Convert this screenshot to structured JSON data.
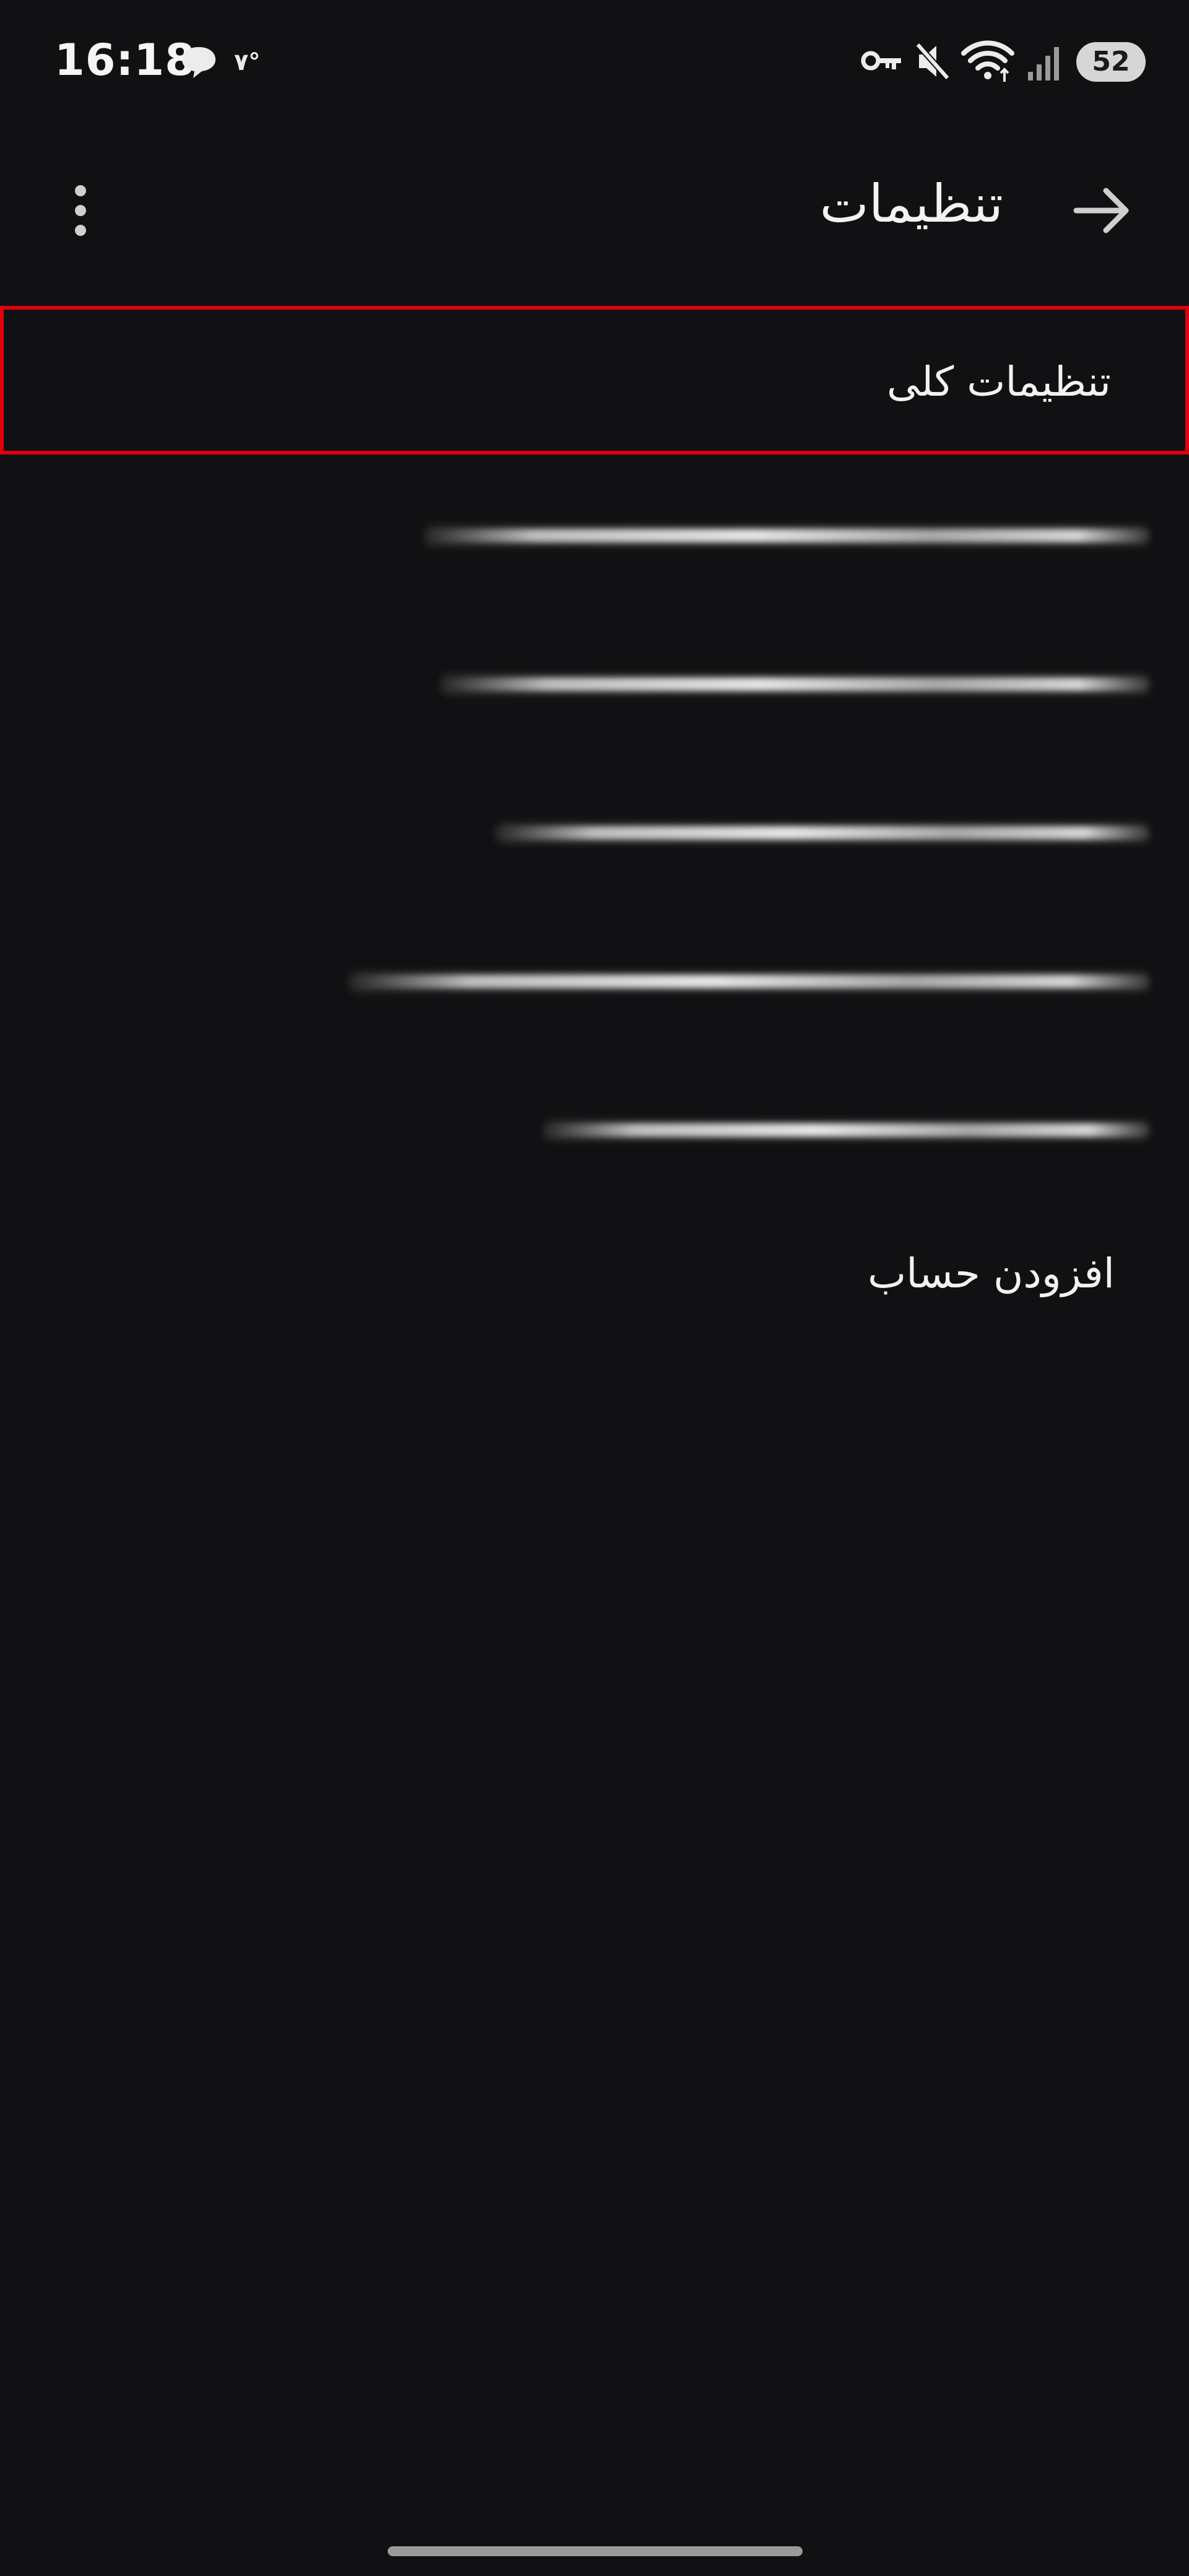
{
  "status_bar": {
    "time": "16:18",
    "temperature": "۷°",
    "battery_level": "52",
    "icons": [
      "chat-bubble-icon",
      "key-icon",
      "mute-vibrate-icon",
      "wifi-icon",
      "signal-icon",
      "battery-icon"
    ]
  },
  "app_bar": {
    "title": "تنظیمات",
    "back_icon": "arrow-right-icon",
    "menu_icon": "more-vertical-icon"
  },
  "settings_list": {
    "general_settings_label": "تنظیمات کلی",
    "add_account_label": "افزودن حساب"
  },
  "colors": {
    "background": "#111113",
    "text": "#f2f2f2",
    "highlight_border": "#e0000e"
  }
}
